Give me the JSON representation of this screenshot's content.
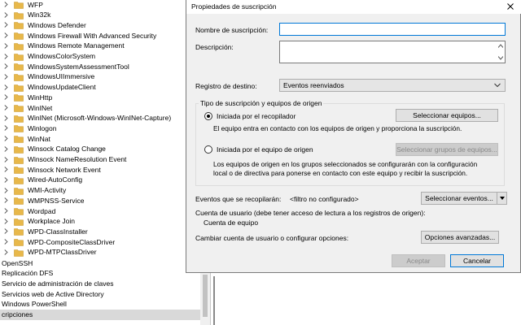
{
  "tree": {
    "folders": [
      {
        "label": "WFP"
      },
      {
        "label": "Win32k"
      },
      {
        "label": "Windows Defender"
      },
      {
        "label": "Windows Firewall With Advanced Security"
      },
      {
        "label": "Windows Remote Management"
      },
      {
        "label": "WindowsColorSystem"
      },
      {
        "label": "WindowsSystemAssessmentTool"
      },
      {
        "label": "WindowsUIImmersive"
      },
      {
        "label": "WindowsUpdateClient"
      },
      {
        "label": "WinHttp"
      },
      {
        "label": "WinINet"
      },
      {
        "label": "WinINet (Microsoft-Windows-WinINet-Capture)"
      },
      {
        "label": "Winlogon"
      },
      {
        "label": "WinNat"
      },
      {
        "label": "Winsock Catalog Change"
      },
      {
        "label": "Winsock NameResolution Event"
      },
      {
        "label": "Winsock Network Event"
      },
      {
        "label": "Wired-AutoConfig"
      },
      {
        "label": "WMI-Activity"
      },
      {
        "label": "WMPNSS-Service"
      },
      {
        "label": "Wordpad"
      },
      {
        "label": "Workplace Join"
      },
      {
        "label": "WPD-ClassInstaller"
      },
      {
        "label": "WPD-CompositeClassDriver"
      },
      {
        "label": "WPD-MTPClassDriver"
      }
    ],
    "plain_items": [
      {
        "label": "OpenSSH"
      },
      {
        "label": "Replicación DFS"
      },
      {
        "label": "Servicio de administración de claves"
      },
      {
        "label": "Servicios web de Active Directory"
      },
      {
        "label": "Windows PowerShell"
      },
      {
        "label": "cripciones"
      }
    ],
    "folder_color": "#e8b84a"
  },
  "dialog": {
    "title": "Propiedades de suscripción",
    "name_label": "Nombre de suscripción:",
    "name_value": "",
    "description_label": "Descripción:",
    "destination_label": "Registro de destino:",
    "destination_value": "Eventos reenviados",
    "group_title": "Tipo de suscripción y equipos de origen",
    "collector_initiated": {
      "label": "Iniciada por el recopilador",
      "selected": true,
      "button": "Seleccionar equipos...",
      "description": "El equipo entra en contacto con los equipos de origen y proporciona la suscripción."
    },
    "source_initiated": {
      "label": "Iniciada por el equipo de origen",
      "selected": false,
      "button": "Seleccionar grupos de equipos...",
      "description_line1": "Los equipos de origen en los grupos seleccionados se configurarán con la configuración",
      "description_line2": "local o de directiva para ponerse en contacto con este equipo y recibir la suscripción."
    },
    "events_label": "Eventos que se recopilarán:",
    "events_value": "<filtro no configurado>",
    "events_button": "Seleccionar eventos...",
    "user_account_label": "Cuenta de usuario (debe tener acceso de lectura a los registros de origen):",
    "user_account_value": "Cuenta de equipo",
    "change_account_label": "Cambiar cuenta de usuario o configurar opciones:",
    "advanced_button": "Opciones avanzadas...",
    "accept_button": "Aceptar",
    "cancel_button": "Cancelar"
  },
  "colors": {
    "accent": "#0078d7",
    "dialog_bg": "#f0f0f0"
  }
}
